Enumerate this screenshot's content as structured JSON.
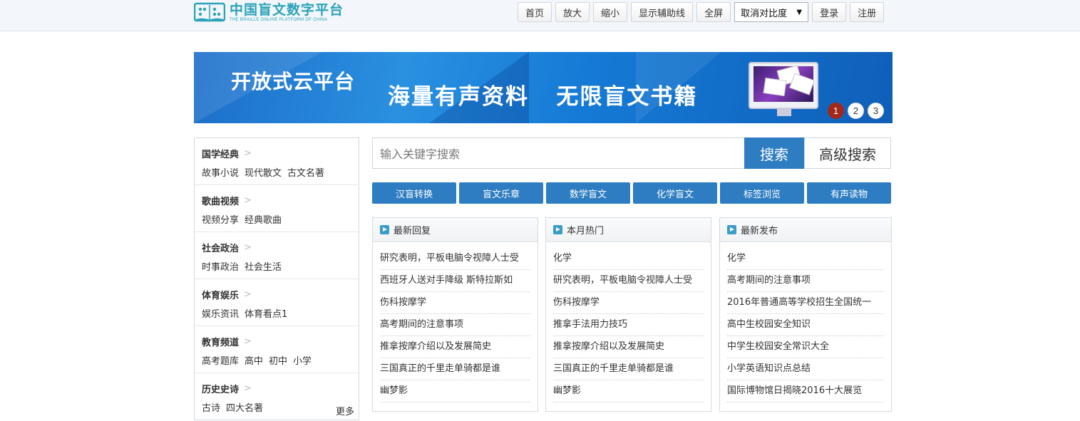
{
  "header": {
    "logo_main": "中国盲文数字平台",
    "logo_sub": "THE BRAILLE ONLINE PLATFORM OF CHINA",
    "buttons": [
      "首页",
      "放大",
      "缩小",
      "显示辅助线",
      "全屏"
    ],
    "contrast_select": "取消对比度",
    "login": "登录",
    "register": "注册"
  },
  "banner": {
    "title": "开放式云平台",
    "subtitle": "海量有声资料   无限盲文书籍",
    "pages": [
      "1",
      "2",
      "3"
    ],
    "active_page": 1
  },
  "sidebar": {
    "categories": [
      {
        "title": "国学经典",
        "links": [
          "故事小说",
          "现代散文",
          "古文名著"
        ]
      },
      {
        "title": "歌曲视频",
        "links": [
          "视频分享",
          "经典歌曲"
        ]
      },
      {
        "title": "社会政治",
        "links": [
          "时事政治",
          "社会生活"
        ]
      },
      {
        "title": "体育娱乐",
        "links": [
          "娱乐资讯",
          "体育看点1"
        ]
      },
      {
        "title": "教育频道",
        "links": [
          "高考题库",
          "高中",
          "初中",
          "小学"
        ]
      },
      {
        "title": "历史史诗",
        "links": [
          "古诗",
          "四大名著"
        ]
      }
    ],
    "more": "更多"
  },
  "search": {
    "placeholder": "输入关键字搜索",
    "button": "搜索",
    "advanced": "高级搜索"
  },
  "features": [
    "汉盲转换",
    "盲文乐章",
    "数学盲文",
    "化学盲文",
    "标签浏览",
    "有声读物"
  ],
  "panels": [
    {
      "title": "最新回复",
      "items": [
        "研究表明，平板电脑令视障人士受",
        "西班牙人送对手降级 斯特拉斯如",
        "伤科按摩学",
        "高考期间的注意事项",
        "推拿按摩介绍以及发展简史",
        "三国真正的千里走单骑都是谁",
        "幽梦影"
      ]
    },
    {
      "title": "本月热门",
      "items": [
        "化学",
        "研究表明，平板电脑令视障人士受",
        "伤科按摩学",
        "推拿手法用力技巧",
        "推拿按摩介绍以及发展简史",
        "三国真正的千里走单骑都是谁",
        "幽梦影"
      ]
    },
    {
      "title": "最新发布",
      "items": [
        "化学",
        "高考期间的注意事项",
        "2016年普通高等学校招生全国统一",
        "高中生校园安全知识",
        "中学生校园安全常识大全",
        "小学英语知识点总结",
        "国际博物馆日揭晓2016十大展览"
      ]
    }
  ],
  "colors": {
    "accent": "#2e7dc2",
    "logo": "#2aa3b8",
    "active_dot": "#a0291c"
  }
}
